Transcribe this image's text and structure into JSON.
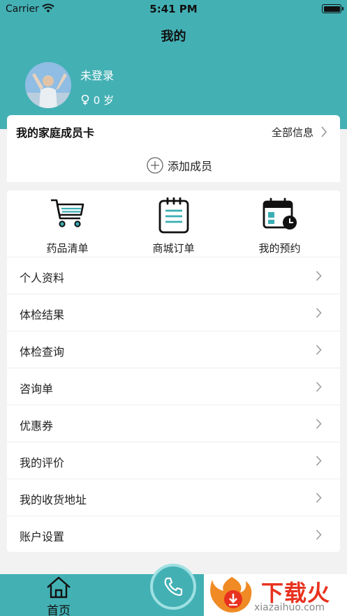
{
  "status_bar": {
    "carrier": "Carrier",
    "time": "5:41 PM"
  },
  "nav": {
    "title": "我的"
  },
  "profile": {
    "name": "未登录",
    "age_text": "0 岁"
  },
  "family": {
    "title": "我的家庭成员卡",
    "all_info": "全部信息",
    "add_member": "添加成员"
  },
  "shortcuts": [
    {
      "label": "药品清单",
      "icon": "shopping-cart-icon"
    },
    {
      "label": "商城订单",
      "icon": "order-list-icon"
    },
    {
      "label": "我的预约",
      "icon": "calendar-clock-icon"
    }
  ],
  "menu": [
    {
      "label": "个人资料"
    },
    {
      "label": "体检结果"
    },
    {
      "label": "体检查询"
    },
    {
      "label": "咨询单"
    },
    {
      "label": "优惠券"
    },
    {
      "label": "我的评价"
    },
    {
      "label": "我的收货地址"
    },
    {
      "label": "账户设置"
    }
  ],
  "tabbar": {
    "home_label": "首页"
  },
  "watermark": {
    "text": "下载火",
    "domain": "xiazaihuo.com"
  },
  "colors": {
    "accent": "#43b0b4",
    "call_ring": "#9fe0e2",
    "watermark_red": "#e8321f"
  }
}
